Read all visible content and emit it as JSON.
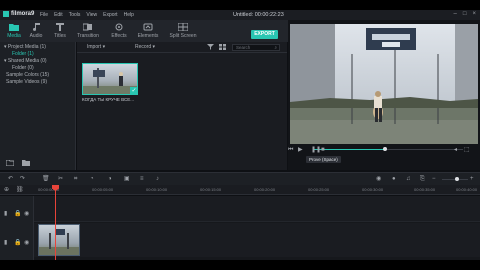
{
  "app": {
    "name": "filmora9",
    "document_title": "Untitled: 00:00:22:23"
  },
  "menu": [
    "File",
    "Edit",
    "Tools",
    "View",
    "Export",
    "Help"
  ],
  "toolbar": {
    "tools": [
      {
        "label": "Media",
        "icon": "folder-icon",
        "active": true
      },
      {
        "label": "Audio",
        "icon": "music-note-icon",
        "active": false
      },
      {
        "label": "Titles",
        "icon": "text-icon",
        "active": false
      },
      {
        "label": "Transition",
        "icon": "transition-icon",
        "active": false
      },
      {
        "label": "Effects",
        "icon": "effects-icon",
        "active": false
      },
      {
        "label": "Elements",
        "icon": "elements-icon",
        "active": false
      },
      {
        "label": "Split Screen",
        "icon": "split-screen-icon",
        "active": false
      }
    ],
    "export_label": "EXPORT"
  },
  "project": {
    "items": [
      {
        "label": "Project Media (1)",
        "active": false
      },
      {
        "label": "Folder (1)",
        "active": true
      },
      {
        "label": "Shared Media (0)",
        "active": false
      },
      {
        "label": "Folder (0)",
        "active": false
      },
      {
        "label": "Sample Colors (15)",
        "active": false
      },
      {
        "label": "Sample Videos (9)",
        "active": false
      }
    ]
  },
  "media": {
    "import_label": "Import",
    "record_label": "Record",
    "search_placeholder": "Search",
    "clip_caption": "КОГДА ТЫ КРУЧЕ ВСЕ..."
  },
  "preview": {
    "tooltip": "Prove (Space)"
  },
  "timeline": {
    "ruler": [
      "00:00:00:00",
      "00:00:05:00",
      "00:00:10:00",
      "00:00:15:00",
      "00:00:20:00",
      "00:00:25:00",
      "00:00:30:00",
      "00:00:35:00",
      "00:00:40:00"
    ]
  },
  "colors": {
    "accent": "#29c6b2",
    "playhead": "#e8443a",
    "background": "#1a1c21"
  }
}
